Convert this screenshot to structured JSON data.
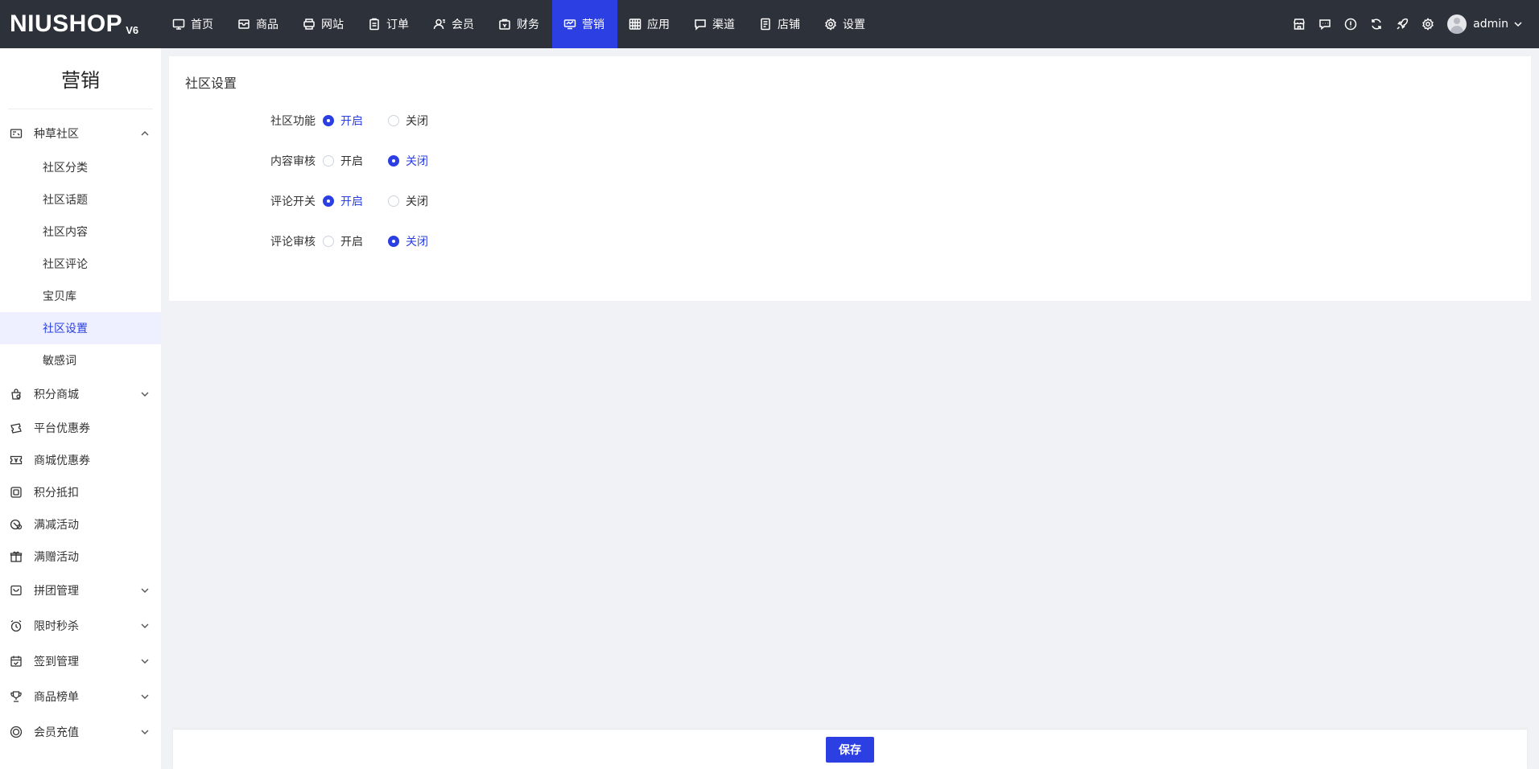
{
  "brand": {
    "name": "NIUSHOP",
    "version": "V6"
  },
  "nav": [
    {
      "label": "首页",
      "icon": "monitor-icon"
    },
    {
      "label": "商品",
      "icon": "box-icon"
    },
    {
      "label": "网站",
      "icon": "printer-icon"
    },
    {
      "label": "订单",
      "icon": "clipboard-icon"
    },
    {
      "label": "会员",
      "icon": "user-icon"
    },
    {
      "label": "财务",
      "icon": "bag-icon"
    },
    {
      "label": "营销",
      "icon": "marketing-icon",
      "active": true
    },
    {
      "label": "应用",
      "icon": "grid-icon"
    },
    {
      "label": "渠道",
      "icon": "screen-icon"
    },
    {
      "label": "店铺",
      "icon": "list-icon"
    },
    {
      "label": "设置",
      "icon": "gear-icon"
    }
  ],
  "topbar": {
    "username": "admin"
  },
  "sidebar": {
    "title": "营销",
    "groups": [
      {
        "label": "种草社区",
        "expanded": true,
        "items": [
          "社区分类",
          "社区话题",
          "社区内容",
          "社区评论",
          "宝贝库",
          "社区设置",
          "敏感词"
        ],
        "active_item": "社区设置"
      },
      {
        "label": "积分商城",
        "expandable": true
      },
      {
        "label": "平台优惠券"
      },
      {
        "label": "商城优惠券"
      },
      {
        "label": "积分抵扣"
      },
      {
        "label": "满减活动"
      },
      {
        "label": "满赠活动"
      },
      {
        "label": "拼团管理",
        "expandable": true
      },
      {
        "label": "限时秒杀",
        "expandable": true
      },
      {
        "label": "签到管理",
        "expandable": true
      },
      {
        "label": "商品榜单",
        "expandable": true
      },
      {
        "label": "会员充值",
        "expandable": true
      }
    ]
  },
  "main": {
    "title": "社区设置",
    "fields": [
      {
        "label": "社区功能",
        "options": [
          "开启",
          "关闭"
        ],
        "selected": "开启"
      },
      {
        "label": "内容审核",
        "options": [
          "开启",
          "关闭"
        ],
        "selected": "关闭"
      },
      {
        "label": "评论开关",
        "options": [
          "开启",
          "关闭"
        ],
        "selected": "开启"
      },
      {
        "label": "评论审核",
        "options": [
          "开启",
          "关闭"
        ],
        "selected": "关闭"
      }
    ]
  },
  "footer": {
    "save_label": "保存"
  },
  "colors": {
    "primary": "#2b3fe2",
    "topbar": "#2d313a",
    "background": "#f0f2f5"
  }
}
